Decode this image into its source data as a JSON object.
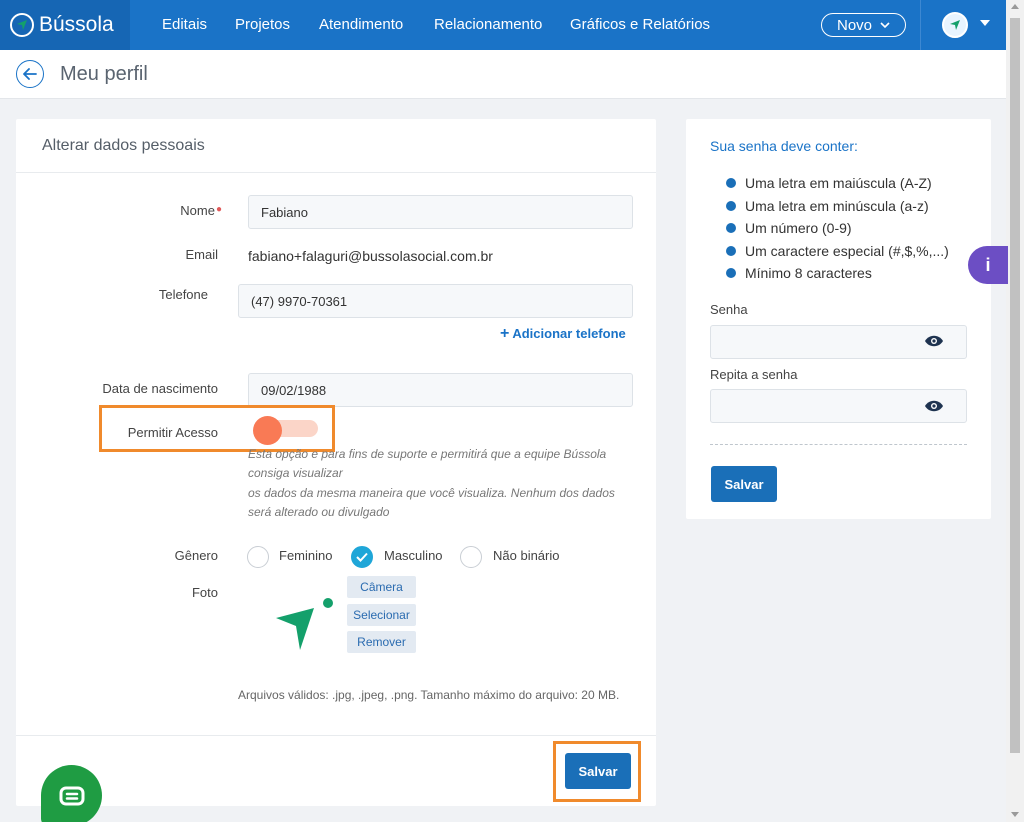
{
  "nav": {
    "logo": "Bússola",
    "items": [
      "Editais",
      "Projetos",
      "Atendimento",
      "Relacionamento",
      "Gráficos e Relatórios"
    ],
    "novo": "Novo"
  },
  "header": {
    "title": "Meu perfil"
  },
  "form": {
    "title": "Alterar dados pessoais",
    "nome_label": "Nome",
    "nome_value": "Fabiano",
    "email_label": "Email",
    "email_value": "fabiano+falaguri@bussolasocial.com.br",
    "telefone_label": "Telefone",
    "telefone_value": "(47) 9970-70361",
    "add_telefone": "Adicionar telefone",
    "nascimento_label": "Data de nascimento",
    "nascimento_value": "09/02/1988",
    "permitir_label": "Permitir Acesso",
    "permitir_help_1": "Esta opção e para fins de suporte e permitirá que a equipe Bússola",
    "permitir_help_2": "consiga visualizar",
    "permitir_help_3": "os dados da mesma maneira que você visualiza. Nenhum dos dados",
    "permitir_help_4": "será alterado ou divulgado",
    "genero_label": "Gênero",
    "genero_options": [
      "Feminino",
      "Masculino",
      "Não binário"
    ],
    "genero_selected": "Masculino",
    "foto_label": "Foto",
    "foto_buttons": [
      "Câmera",
      "Selecionar",
      "Remover"
    ],
    "files_note": "Arquivos válidos: .jpg, .jpeg, .png. Tamanho máximo do arquivo: 20 MB.",
    "save": "Salvar"
  },
  "password": {
    "title": "Sua senha deve conter:",
    "rules": [
      "Uma letra em maiúscula (A-Z)",
      "Uma letra em minúscula (a-z)",
      "Um número (0-9)",
      "Um caractere especial (#,$,%,...)",
      "Mínimo 8 caracteres"
    ],
    "senha_label": "Senha",
    "repita_label": "Repita a senha",
    "save": "Salvar"
  },
  "info_tab": "i",
  "colors": {
    "brand": "#1a73c7",
    "highlight": "#f08a2c",
    "toggle": "#f97a55",
    "logo_green": "#14a06b",
    "chat": "#1f9c43"
  }
}
